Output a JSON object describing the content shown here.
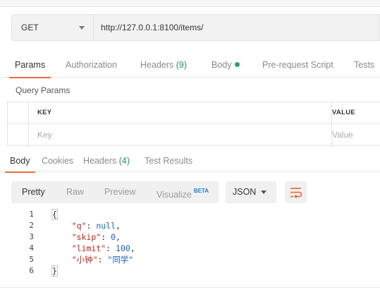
{
  "request": {
    "method": "GET",
    "url": "http://127.0.0.1:8100/items/"
  },
  "req_tabs": {
    "params": "Params",
    "authorization": "Authorization",
    "headers": "Headers",
    "headers_count": "(9)",
    "body": "Body",
    "pre_request": "Pre-request Script",
    "tests": "Tests"
  },
  "query_params": {
    "title": "Query Params",
    "col_key": "KEY",
    "col_value": "VALUE",
    "key_placeholder": "Key",
    "value_placeholder": "Value"
  },
  "resp_tabs": {
    "body": "Body",
    "cookies": "Cookies",
    "headers": "Headers",
    "headers_count": "(4)",
    "test_results": "Test Results"
  },
  "toolbar": {
    "pretty": "Pretty",
    "raw": "Raw",
    "preview": "Preview",
    "visualize": "Visualize",
    "beta": "BETA",
    "language": "JSON"
  },
  "code": {
    "line_numbers": [
      "1",
      "2",
      "3",
      "4",
      "5",
      "6"
    ],
    "open_brace": "{",
    "close_brace": "}",
    "entries": [
      {
        "key": "\"q\"",
        "value": "null"
      },
      {
        "key": "\"skip\"",
        "value": "0"
      },
      {
        "key": "\"limit\"",
        "value": "100"
      },
      {
        "key": "\"小钟\"",
        "value": "\"同学\""
      }
    ]
  },
  "colors": {
    "accent": "#f26b3a",
    "count_green": "#2d8f5a",
    "dot_green": "#2ea462",
    "json_key": "#b3261e",
    "json_value": "#1f5fbf"
  },
  "icons": {
    "method_dropdown": "chevron-down-icon",
    "body_indicator": "dot-icon",
    "wrap": "wrap-lines-icon"
  }
}
